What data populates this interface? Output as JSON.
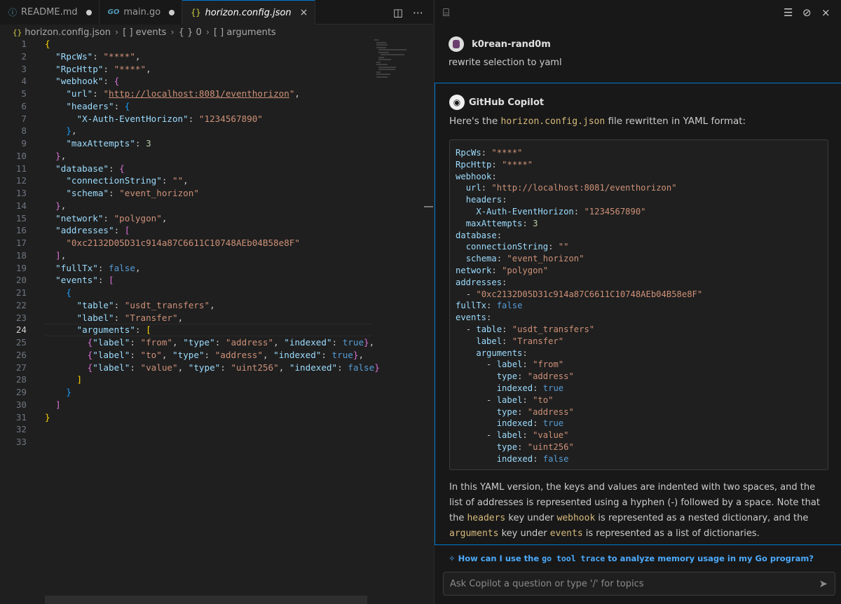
{
  "tabs": [
    {
      "icon": "ⓘ",
      "label": "README.md",
      "state": "modified"
    },
    {
      "icon": "GO",
      "label": "main.go",
      "state": "modified"
    },
    {
      "icon": "{}",
      "label": "horizon.config.json",
      "state": "active"
    }
  ],
  "breadcrumb": [
    "horizon.config.json",
    "[ ] events",
    "{ } 0",
    "[ ] arguments"
  ],
  "editor": {
    "current_line": 24,
    "line_numbers": [
      "1",
      "2",
      "3",
      "4",
      "5",
      "6",
      "7",
      "8",
      "9",
      "10",
      "11",
      "12",
      "13",
      "14",
      "15",
      "16",
      "17",
      "18",
      "19",
      "20",
      "21",
      "22",
      "23",
      "24",
      "25",
      "26",
      "27",
      "28",
      "29",
      "30",
      "31",
      "32",
      "33"
    ]
  },
  "chat": {
    "user": {
      "name": "k0rean-rand0m",
      "message": "rewrite selection to yaml"
    },
    "assistant": {
      "name": "GitHub Copilot",
      "intro_before": "Here's the ",
      "intro_code": "horizon.config.json",
      "intro_after": " file rewritten in YAML format:",
      "body_1": "In this YAML version, the keys and values are indented with two spaces, and the list of addresses is represented using a hyphen (-) followed by a space. Note that the ",
      "body_code_1": "headers",
      "body_2": " key under ",
      "body_code_2": "webhook",
      "body_3": " is represented as a nested dictionary, and the ",
      "body_code_3": "arguments",
      "body_4": " key under ",
      "body_code_4": "events",
      "body_5": " is represented as a list of dictionaries."
    },
    "suggestion_before": "How can I use the ",
    "suggestion_code": "go tool trace",
    "suggestion_after": " to analyze memory usage in my Go program?",
    "input_placeholder": "Ask Copilot a question or type '/' for topics"
  }
}
